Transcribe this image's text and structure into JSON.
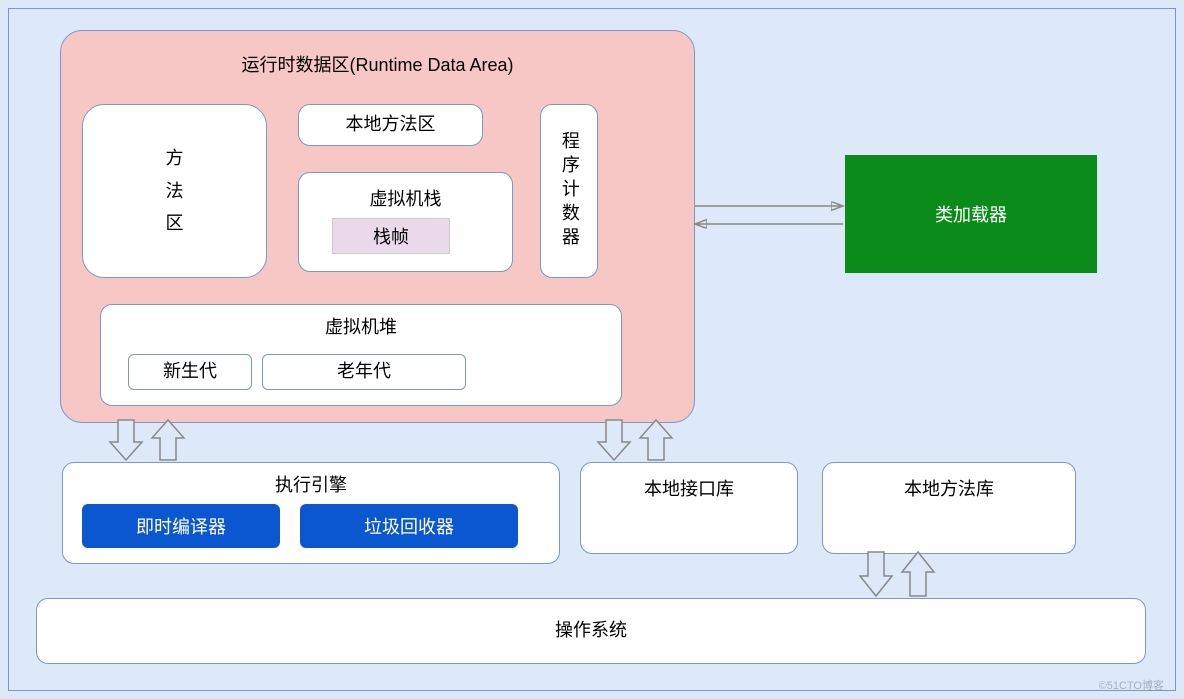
{
  "runtime": {
    "title": "运行时数据区(Runtime Data Area)",
    "method_area": "方\n法\n区",
    "native_method_area": "本地方法区",
    "vm_stack": "虚拟机栈",
    "stack_frame": "栈帧",
    "program_counter": "程序计数器",
    "heap": "虚拟机堆",
    "young_gen": "新生代",
    "old_gen": "老年代"
  },
  "classloader": "类加载器",
  "exec_engine": {
    "title": "执行引擎",
    "jit": "即时编译器",
    "gc": "垃圾回收器"
  },
  "native_interface_lib": "本地接口库",
  "native_method_lib": "本地方法库",
  "os": "操作系统",
  "watermark": "©51CTO博客"
}
